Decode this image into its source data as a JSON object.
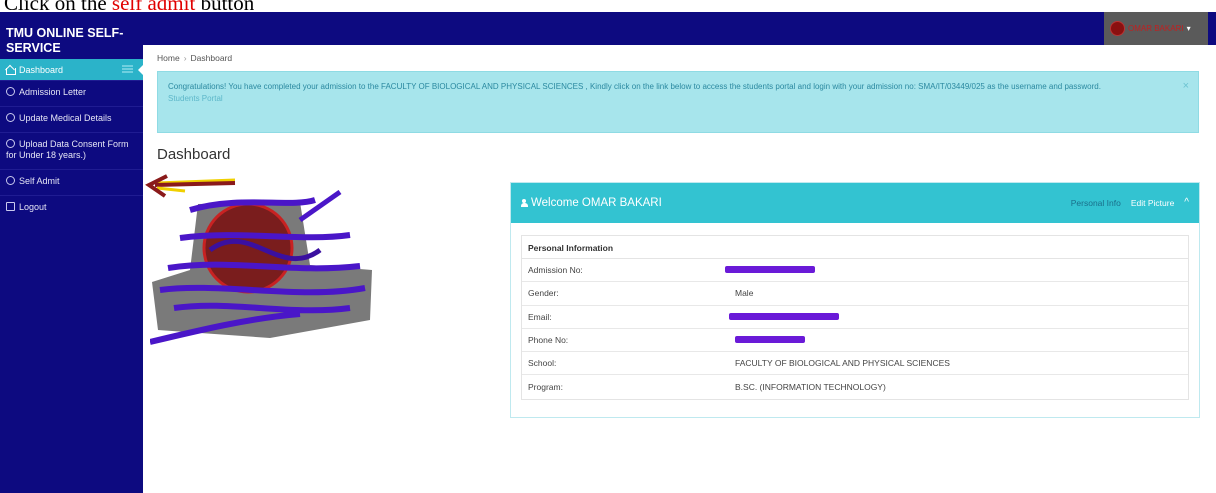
{
  "caption": {
    "prefix": "Click on the ",
    "highlight": "self admit",
    "suffix": " button"
  },
  "header": {
    "brand": "TMU ONLINE SELF-SERVICE",
    "user_name": "OMAR BAKARI"
  },
  "sidebar": {
    "items": [
      {
        "label": "Dashboard",
        "icon": "home-icon",
        "active": true
      },
      {
        "label": "Admission Letter",
        "icon": "user-circle-icon"
      },
      {
        "label": "Update Medical Details",
        "icon": "user-circle-icon"
      },
      {
        "label": "Upload Data Consent Form",
        "label2": "for Under 18 years.)",
        "icon": "user-circle-icon"
      },
      {
        "label": "Self Admit",
        "icon": "user-circle-icon"
      },
      {
        "label": "Logout",
        "icon": "logout-icon"
      }
    ]
  },
  "breadcrumb": {
    "home": "Home",
    "separator": "›",
    "current": "Dashboard"
  },
  "alert": {
    "message": "Congratulations! You have completed your admission to the FACULTY OF BIOLOGICAL AND PHYSICAL SCIENCES , Kindly click on the link below to access the students portal and login with your admission no: SMA/IT/03449/025 as the username and password.",
    "link": "Students Portal",
    "close": "×"
  },
  "page": {
    "title": "Dashboard"
  },
  "panel": {
    "welcome": "Welcome OMAR BAKARI",
    "personal_info": "Personal Info",
    "edit_picture": "Edit Picture",
    "collapse": "^",
    "table_title": "Personal Information",
    "rows": [
      {
        "key": "Admission No:",
        "value": "",
        "redacted": true
      },
      {
        "key": "Gender:",
        "value": "Male"
      },
      {
        "key": "Email:",
        "value": "",
        "redacted": true
      },
      {
        "key": "Phone No:",
        "value": "",
        "redacted": true
      },
      {
        "key": "School:",
        "value": "FACULTY OF BIOLOGICAL AND PHYSICAL SCIENCES"
      },
      {
        "key": "Program:",
        "value": "B.SC. (INFORMATION TECHNOLOGY)"
      }
    ]
  },
  "colors": {
    "navy": "#0d0a80",
    "accent_teal": "#33c3d1",
    "alert_bg": "#a7e5ec",
    "redaction_purple": "#6a1ad8",
    "annotation_red": "#e00000"
  }
}
